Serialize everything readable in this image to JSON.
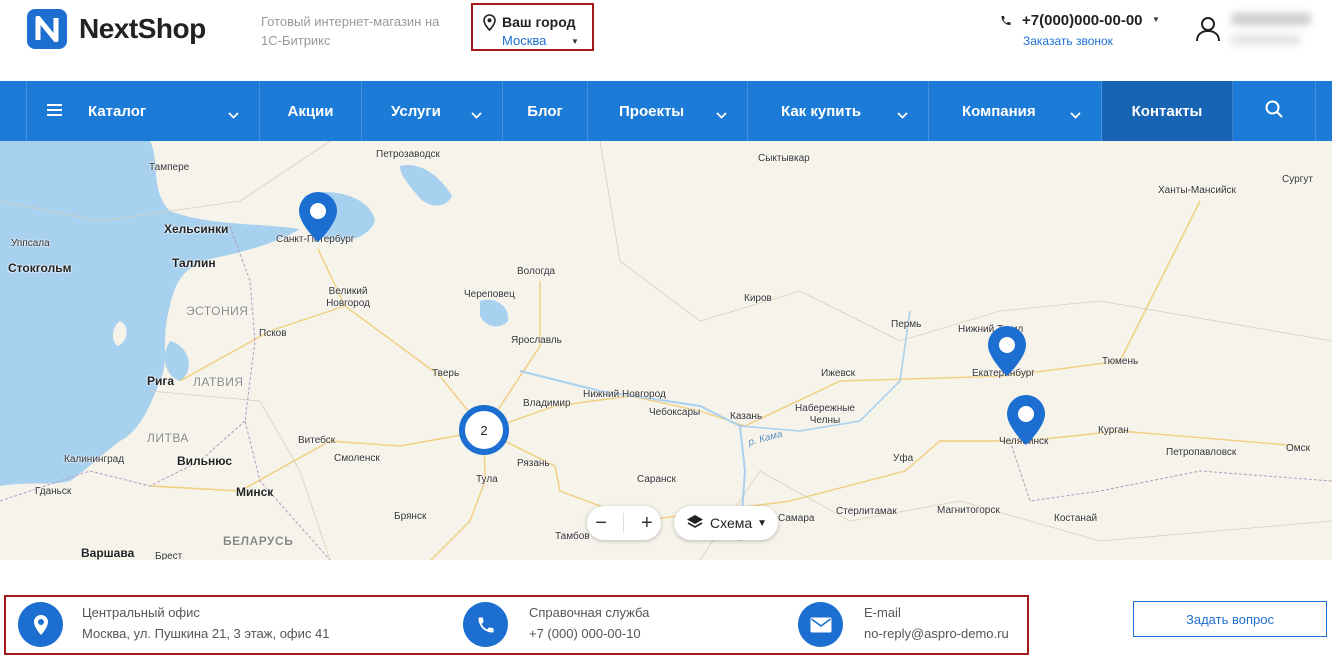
{
  "header": {
    "logo_text": "NextShop",
    "tagline": "Готовый интернет-магазин на 1С-Битрикс",
    "city": {
      "title": "Ваш город",
      "value": "Москва"
    },
    "phone": {
      "number": "+7(000)000-00-00",
      "callback": "Заказать звонок"
    }
  },
  "nav": {
    "items": [
      {
        "label": "Каталог",
        "has_menu_icon": true,
        "has_chevron": true
      },
      {
        "label": "Акции",
        "has_chevron": false
      },
      {
        "label": "Услуги",
        "has_chevron": true
      },
      {
        "label": "Блог",
        "has_chevron": false
      },
      {
        "label": "Проекты",
        "has_chevron": true
      },
      {
        "label": "Как купить",
        "has_chevron": true
      },
      {
        "label": "Компания",
        "has_chevron": true
      },
      {
        "label": "Контакты",
        "has_chevron": false,
        "active": true
      }
    ]
  },
  "map": {
    "cluster_count": "2",
    "layer_label": "Схема",
    "labels": {
      "tampere": "Тампере",
      "petrozavodsk": "Петрозаводск",
      "syktyvkar": "Сыктывкар",
      "surgut": "Сургут",
      "khanty": "Ханты-Мансийск",
      "helsinki": "Хельсинки",
      "spb": "Санкт-Петербург",
      "uppsala": "Уппсала",
      "stockholm": "Стокгольм",
      "tallinn": "Таллин",
      "vologda": "Вологда",
      "cherepovets": "Череповец",
      "kirov": "Киров",
      "estonia": "ЭСТОНИЯ",
      "novgorod": "Великий Новгород",
      "perm": "Пермь",
      "ntagil": "Нижний Тагил",
      "pskov": "Псков",
      "yaroslavl": "Ярославль",
      "tyumen": "Тюмень",
      "riga": "Рига",
      "latvia": "ЛАТВИЯ",
      "tver": "Тверь",
      "ekb": "Екатеринбург",
      "izhevsk": "Ижевск",
      "nnovgorod": "Нижний Новгород",
      "vladimir": "Владимир",
      "cheboksary": "Чебоксары",
      "nchelny": "Набережные Челны",
      "kazan": "Казань",
      "kama": "р. Кама",
      "litva": "ЛИТВА",
      "chelyabinsk": "Челябинск",
      "kurgan": "Курган",
      "vitebsk": "Витебск",
      "smolensk": "Смоленск",
      "ufa": "Уфа",
      "omsk": "Омск",
      "kaliningrad": "Калининград",
      "vilnius": "Вильнюс",
      "ryazan": "Рязань",
      "petropavlovsk": "Петропавловск",
      "tula": "Тула",
      "saransk": "Саранск",
      "gdansk": "Гданьск",
      "minsk": "Минск",
      "samara": "Самара",
      "sterlitamak": "Стерлитамак",
      "magnitogorsk": "Магнитогорск",
      "kostanay": "Костанай",
      "bryansk": "Брянск",
      "belarus": "БЕЛАРУСЬ",
      "warsaw": "Варшава",
      "tambov": "Тамбов",
      "brest": "Брест"
    }
  },
  "contacts": {
    "office": {
      "title": "Центральный офис",
      "value": "Москва, ул. Пушкина 21, 3 этаж, офис 41"
    },
    "help": {
      "title": "Справочная служба",
      "value": "+7 (000) 000-00-10"
    },
    "email": {
      "title": "E-mail",
      "value": "no-reply@aspro-demo.ru"
    }
  },
  "ask_button": "Задать вопрос",
  "colors": {
    "accent": "#1c6fd1",
    "nav_bg": "#1c7bd6",
    "nav_active": "#1763b4",
    "highlight_border": "#a3191a"
  }
}
